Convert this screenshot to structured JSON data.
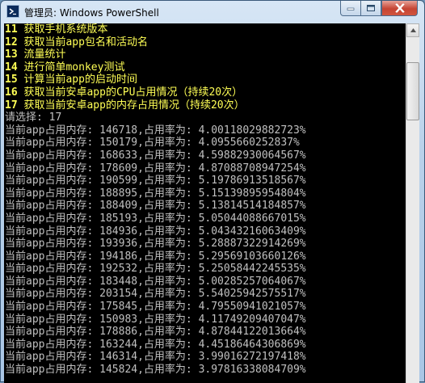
{
  "window": {
    "title": "管理员: Windows PowerShell"
  },
  "menu_items": [
    {
      "num": "11",
      "text": " 获取手机系统版本"
    },
    {
      "num": "12",
      "text": " 获取当前app包名和活动名"
    },
    {
      "num": "13",
      "text": " 流量统计"
    },
    {
      "num": "14",
      "text": " 进行简单monkey测试"
    },
    {
      "num": "15",
      "text": " 计算当前app的启动时间"
    },
    {
      "num": "16",
      "text": " 获取当前安卓app的CPU占用情况（持续20次）"
    },
    {
      "num": "17",
      "text": " 获取当前安卓app的内存占用情况（持续20次）"
    }
  ],
  "prompt": "请选择: 17",
  "output_lines": [
    "当前app占用内存: 146718,占用率为: 4.00118029882723%",
    "当前app占用内存: 150179,占用率为: 4.0955660252837%",
    "当前app占用内存: 168633,占用率为: 4.59882930064567%",
    "当前app占用内存: 178609,占用率为: 4.87088708947254%",
    "当前app占用内存: 190599,占用率为: 5.19786913518567%",
    "当前app占用内存: 188895,占用率为: 5.15139895954804%",
    "当前app占用内存: 188409,占用率为: 5.13814514184857%",
    "当前app占用内存: 185193,占用率为: 5.05044088667015%",
    "当前app占用内存: 184936,占用率为: 5.04343216063409%",
    "当前app占用内存: 193936,占用率为: 5.28887322914269%",
    "当前app占用内存: 194186,占用率为: 5.29569103660126%",
    "当前app占用内存: 192532,占用率为: 5.25058442245535%",
    "当前app占用内存: 183448,占用率为: 5.00285257064067%",
    "当前app占用内存: 203154,占用率为: 5.54025942575517%",
    "当前app占用内存: 175845,占用率为: 4.79550941021057%",
    "当前app占用内存: 150983,占用率为: 4.11749209407047%",
    "当前app占用内存: 178886,占用率为: 4.87844122013664%",
    "当前app占用内存: 163244,占用率为: 4.45186464306869%",
    "当前app占用内存: 146314,占用率为: 3.99016272197418%",
    "当前app占用内存: 145824,占用率为: 3.97816338084709%"
  ],
  "icons": {
    "app": "powershell-icon",
    "minimize": "minimize-icon",
    "maximize": "maximize-icon",
    "close": "close-icon",
    "scroll_up": "scroll-up-arrow-icon"
  },
  "colors": {
    "console_bg": "#000000",
    "menu_text": "#ffff55",
    "output_text": "#c0c0c0"
  }
}
